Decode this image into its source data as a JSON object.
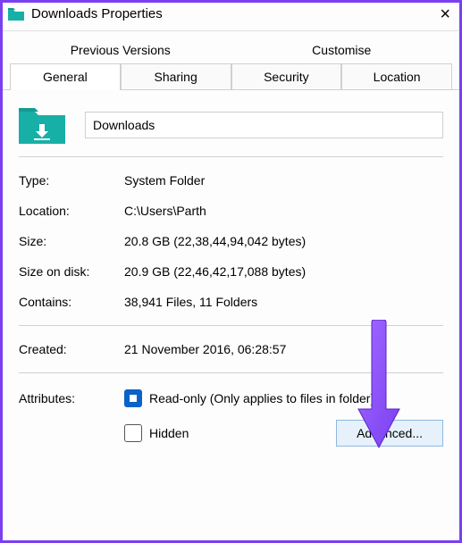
{
  "window": {
    "title": "Downloads Properties"
  },
  "tabs": {
    "top": [
      {
        "label": "Previous Versions"
      },
      {
        "label": "Customise"
      }
    ],
    "bottom": [
      {
        "label": "General"
      },
      {
        "label": "Sharing"
      },
      {
        "label": "Security"
      },
      {
        "label": "Location"
      }
    ]
  },
  "folder_name": "Downloads",
  "props": {
    "type_label": "Type:",
    "type_value": "System Folder",
    "location_label": "Location:",
    "location_value": "C:\\Users\\Parth",
    "size_label": "Size:",
    "size_value": "20.8 GB (22,38,44,94,042 bytes)",
    "size_on_disk_label": "Size on disk:",
    "size_on_disk_value": "20.9 GB (22,46,42,17,088 bytes)",
    "contains_label": "Contains:",
    "contains_value": "38,941 Files, 11 Folders",
    "created_label": "Created:",
    "created_value": "21 November 2016, 06:28:57"
  },
  "attributes": {
    "label": "Attributes:",
    "readonly_label": "Read-only (Only applies to files in folder)",
    "hidden_label": "Hidden",
    "advanced_label": "Advanced..."
  }
}
